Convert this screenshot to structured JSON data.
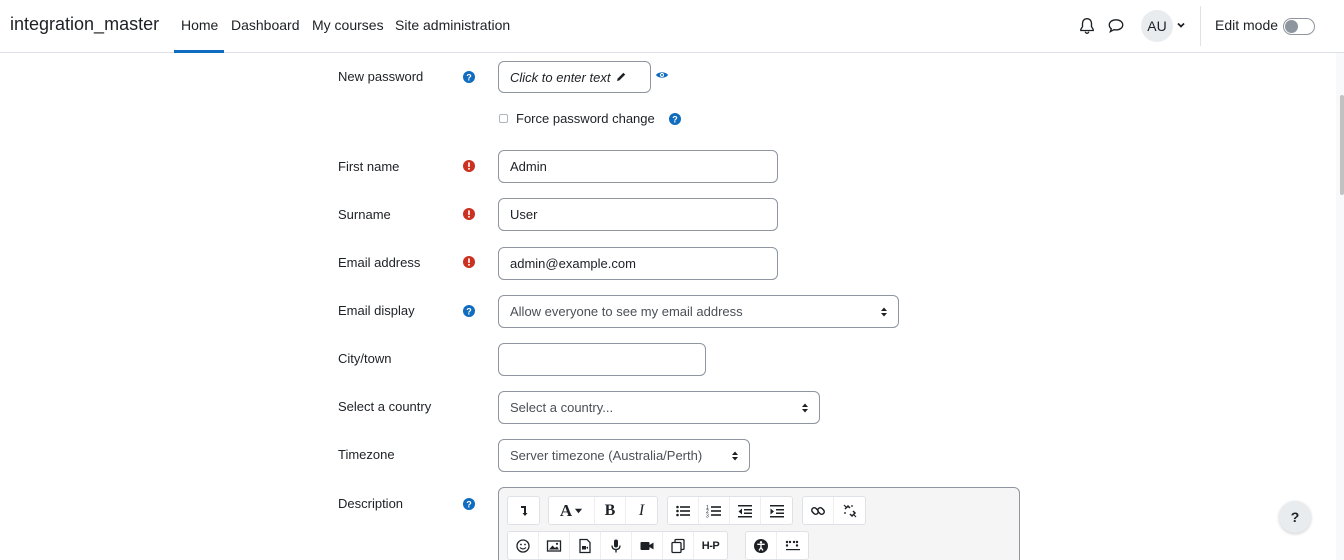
{
  "navbar": {
    "brand": "integration_master",
    "items": [
      {
        "label": "Home"
      },
      {
        "label": "Dashboard"
      },
      {
        "label": "My courses"
      },
      {
        "label": "Site administration"
      }
    ],
    "avatar_initials": "AU",
    "edit_mode_label": "Edit mode",
    "edit_mode_on": false
  },
  "form": {
    "new_password": {
      "label": "New password",
      "placeholder_text": "Click to enter text"
    },
    "force_password_change": {
      "label": "Force password change",
      "checked": false
    },
    "first_name": {
      "label": "First name",
      "value": "Admin"
    },
    "surname": {
      "label": "Surname",
      "value": "User"
    },
    "email": {
      "label": "Email address",
      "value": "admin@example.com"
    },
    "email_display": {
      "label": "Email display",
      "value": "Allow everyone to see my email address"
    },
    "city": {
      "label": "City/town",
      "value": ""
    },
    "country": {
      "label": "Select a country",
      "value": "Select a country..."
    },
    "timezone": {
      "label": "Timezone",
      "value": "Server timezone (Australia/Perth)"
    },
    "description": {
      "label": "Description"
    }
  },
  "editor": {
    "font_button": "A",
    "bold": "B",
    "italic": "I",
    "h5p": "H-P"
  },
  "help_button": "?",
  "colors": {
    "accent": "#0f6cbf",
    "help": "#0f6cbf",
    "required": "#ca3120"
  }
}
